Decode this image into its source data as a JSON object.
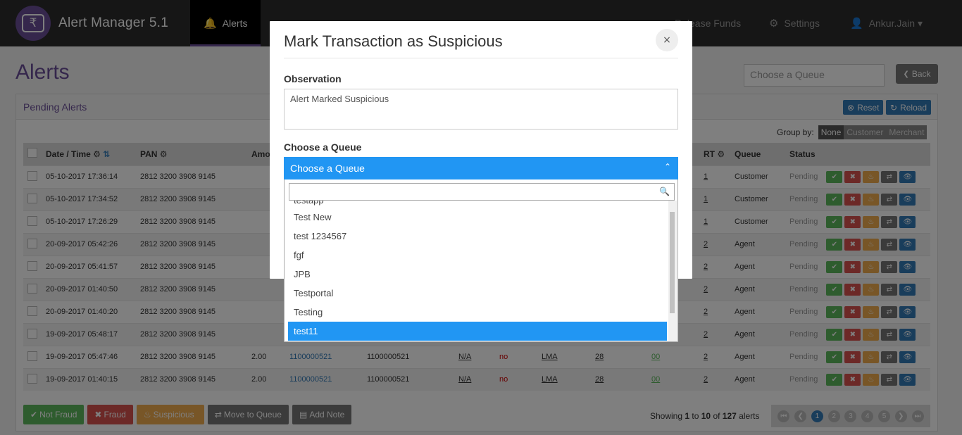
{
  "app": {
    "title": "Alert Manager 5.1",
    "logo_glyph": "₹"
  },
  "nav": {
    "items": [
      {
        "label": "Alerts",
        "icon": "bell-icon",
        "glyph": "🔔",
        "active": true
      },
      {
        "label": "Settings",
        "icon": "gear-icon",
        "glyph": "⚙",
        "active": false
      },
      {
        "label": "Ankur.Jain ▾",
        "icon": "user-icon",
        "glyph": "👤",
        "active": false
      }
    ],
    "release_funds": "Release Funds"
  },
  "page": {
    "title": "Alerts",
    "queue_placeholder": "Choose a Queue",
    "back_label": "Back"
  },
  "panel": {
    "heading": "Pending Alerts",
    "reset_label": "Reset",
    "reload_label": "Reload",
    "group_by_label": "Group by:",
    "group_by_options": [
      "None",
      "Customer",
      "Merchant"
    ],
    "columns": {
      "datetime": "Date / Time",
      "pan": "PAN",
      "amount": "Amo",
      "rt": "RT",
      "queue": "Queue",
      "status": "Status"
    },
    "rows": [
      {
        "datetime": "05-10-2017 17:36:14",
        "pan": "2812 3200 3908 9145",
        "rt": "1",
        "queue": "Customer",
        "status": "Pending"
      },
      {
        "datetime": "05-10-2017 17:34:52",
        "pan": "2812 3200 3908 9145",
        "rt": "1",
        "queue": "Customer",
        "status": "Pending"
      },
      {
        "datetime": "05-10-2017 17:26:29",
        "pan": "2812 3200 3908 9145",
        "rt": "1",
        "queue": "Customer",
        "status": "Pending"
      },
      {
        "datetime": "20-09-2017 05:42:26",
        "pan": "2812 3200 3908 9145",
        "rt": "2",
        "queue": "Agent",
        "status": "Pending"
      },
      {
        "datetime": "20-09-2017 05:41:57",
        "pan": "2812 3200 3908 9145",
        "rt": "2",
        "queue": "Agent",
        "status": "Pending"
      },
      {
        "datetime": "20-09-2017 01:40:50",
        "pan": "2812 3200 3908 9145",
        "rt": "2",
        "queue": "Agent",
        "status": "Pending"
      },
      {
        "datetime": "20-09-2017 01:40:20",
        "pan": "2812 3200 3908 9145",
        "rt": "2",
        "queue": "Agent",
        "status": "Pending"
      },
      {
        "datetime": "19-09-2017 05:48:17",
        "pan": "2812 3200 3908 9145",
        "rt": "2",
        "queue": "Agent",
        "status": "Pending"
      },
      {
        "datetime": "19-09-2017 05:47:46",
        "pan": "2812 3200 3908 9145",
        "amount": "2.00",
        "mid": "1100000521",
        "tid": "1100000521",
        "na": "N/A",
        "flag": "no",
        "lma": "LMA",
        "n28": "28",
        "n00": "00",
        "rt": "2",
        "queue": "Agent",
        "status": "Pending"
      },
      {
        "datetime": "19-09-2017 01:40:15",
        "pan": "2812 3200 3908 9145",
        "amount": "2.00",
        "mid": "1100000521",
        "tid": "1100000521",
        "na": "N/A",
        "flag": "no",
        "lma": "LMA",
        "n28": "28",
        "n00": "00",
        "rt": "2",
        "queue": "Agent",
        "status": "Pending"
      }
    ],
    "bottom_buttons": [
      "Not Fraud",
      "Fraud",
      "Suspicious",
      "Move to Queue",
      "Add Note"
    ],
    "showing": {
      "prefix": "Showing ",
      "from": "1",
      "to_word": " to ",
      "to": "10",
      "of_word": " of ",
      "total": "127",
      "suffix": " alerts"
    },
    "pages": [
      "1",
      "2",
      "3",
      "4",
      "5"
    ]
  },
  "modal": {
    "title": "Mark Transaction as Suspicious",
    "close_glyph": "×",
    "observation_label": "Observation",
    "observation_value": "Alert Marked Suspicious",
    "queue_label": "Choose a Queue",
    "dropdown_selected": "Choose a Queue",
    "options_partial": "testapp",
    "options": [
      "Test New",
      "test 1234567",
      "fgf",
      "JPB",
      "Testportal",
      "Testing",
      "test11"
    ],
    "highlighted": "test11"
  },
  "colors": {
    "brand": "#6b4e99",
    "primary": "#2196f3",
    "navbar": "#2d2d2d"
  }
}
